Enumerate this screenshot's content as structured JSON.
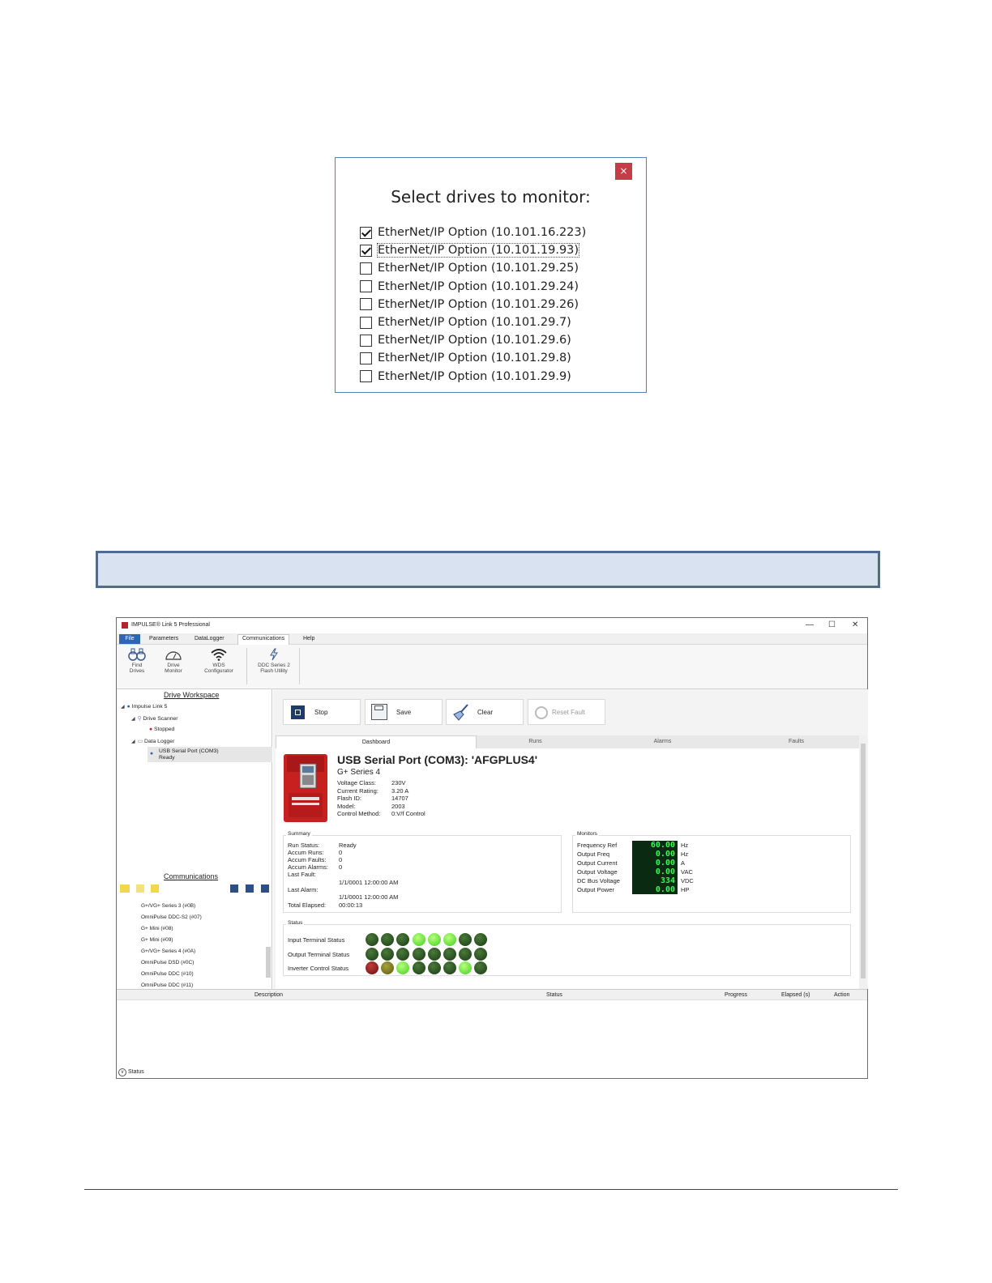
{
  "dialog": {
    "close": "×",
    "title": "Select drives to monitor:",
    "items": [
      {
        "label": "EtherNet/IP Option (10.101.16.223)",
        "checked": true
      },
      {
        "label": "EtherNet/IP Option (10.101.19.93)",
        "checked": true
      },
      {
        "label": "EtherNet/IP Option (10.101.29.25)",
        "checked": false
      },
      {
        "label": "EtherNet/IP Option (10.101.29.24)",
        "checked": false
      },
      {
        "label": "EtherNet/IP Option (10.101.29.26)",
        "checked": false
      },
      {
        "label": "EtherNet/IP Option (10.101.29.7)",
        "checked": false
      },
      {
        "label": "EtherNet/IP Option (10.101.29.6)",
        "checked": false
      },
      {
        "label": "EtherNet/IP Option (10.101.29.8)",
        "checked": false
      },
      {
        "label": "EtherNet/IP Option (10.101.29.9)",
        "checked": false
      }
    ]
  },
  "app": {
    "title": "IMPULSE® Link 5 Professional",
    "window": {
      "minimize": "—",
      "maximize": "☐",
      "close": "✕"
    },
    "menu": {
      "file": "File",
      "parameters": "Parameters",
      "datalogger": "DataLogger",
      "communications": "Communications",
      "help": "Help"
    },
    "ribbon": {
      "find_drives": [
        "Find",
        "Drives"
      ],
      "drive_monitor": [
        "Drive",
        "Monitor"
      ],
      "wds": [
        "WDS",
        "Configurator"
      ],
      "ddc": [
        "DDC Series 2",
        "Flash Utility"
      ]
    },
    "workspace": {
      "title": "Drive Workspace",
      "root": "Impulse Link 5",
      "scanner": "Drive Scanner",
      "stopped": "Stopped",
      "logger": "Data Logger",
      "usb": "USB Serial Port (COM3)",
      "ready": "Ready"
    },
    "communications": {
      "title": "Communications",
      "items": [
        "G+/VG+ Series 3 (#0B)",
        "OmniPulse DDC-S2 (#07)",
        "G+ Mini (#08)",
        "G+ Mini (#09)",
        "G+/VG+ Series 4 (#0A)",
        "OmniPulse DSD (#0C)",
        "OmniPulse DDC (#10)",
        "OmniPulse DDC (#11)"
      ]
    },
    "toolbar": {
      "stop": "Stop",
      "save": "Save",
      "clear": "Clear",
      "reset": "Reset Fault"
    },
    "tabs": {
      "dashboard": "Dashboard",
      "runs": "Runs",
      "alarms": "Alarms",
      "faults": "Faults"
    },
    "drive": {
      "name": "USB Serial Port (COM3): 'AFGPLUS4'",
      "series": "G+ Series 4",
      "specs": [
        {
          "k": "Voltage Class:",
          "v": "230V"
        },
        {
          "k": "Current Rating:",
          "v": "3.20 A"
        },
        {
          "k": "Flash ID:",
          "v": "14707"
        },
        {
          "k": "Model:",
          "v": "2003"
        },
        {
          "k": "Control Method:",
          "v": "0:V/f Control"
        }
      ]
    },
    "summary": {
      "title": "Summary",
      "run_status_k": "Run Status:",
      "run_status_v": "Ready",
      "accum_runs_k": "Accum Runs:",
      "accum_runs_v": "0",
      "accum_faults_k": "Accum Faults:",
      "accum_faults_v": "0",
      "accum_alarms_k": "Accum Alarms:",
      "accum_alarms_v": "0",
      "last_fault_k": "Last Fault:",
      "last_fault_v": "1/1/0001 12:00:00 AM",
      "last_alarm_k": "Last Alarm:",
      "last_alarm_v": "1/1/0001 12:00:00 AM",
      "elapsed_k": "Total Elapsed:",
      "elapsed_v": "00:00:13"
    },
    "monitors": {
      "title": "Monitors",
      "rows": [
        {
          "label": "Frequency Ref",
          "value": "60.00",
          "unit": "Hz"
        },
        {
          "label": "Output Freq",
          "value": "0.00",
          "unit": "Hz"
        },
        {
          "label": "Output Current",
          "value": "0.00",
          "unit": "A"
        },
        {
          "label": "Output Voltage",
          "value": "0.00",
          "unit": "VAC"
        },
        {
          "label": "DC Bus Voltage",
          "value": "334",
          "unit": "VDC"
        },
        {
          "label": "Output Power",
          "value": "0.00",
          "unit": "HP"
        }
      ]
    },
    "status": {
      "title": "Status",
      "rows": [
        {
          "label": "Input Terminal Status",
          "leds": [
            "dark",
            "dark",
            "dark",
            "bright",
            "bright",
            "bright",
            "dark",
            "dark"
          ]
        },
        {
          "label": "Output Terminal Status",
          "leds": [
            "dark",
            "dark",
            "dark",
            "dark",
            "dark",
            "dark",
            "dark",
            "dark"
          ]
        },
        {
          "label": "Inverter Control Status",
          "leds": [
            "red",
            "olive",
            "bright",
            "dark",
            "dark",
            "dark",
            "bright",
            "dark"
          ]
        }
      ]
    },
    "bottom": {
      "description": "Description",
      "status": "Status",
      "progress": "Progress",
      "elapsed": "Elapsed (s)",
      "action": "Action"
    },
    "footer_status": "Status"
  }
}
